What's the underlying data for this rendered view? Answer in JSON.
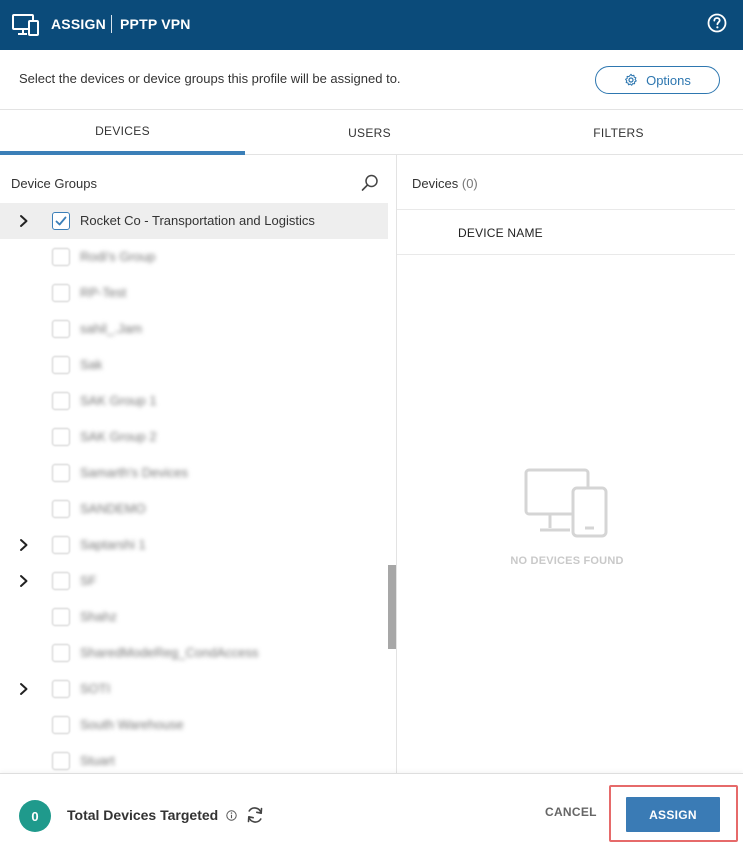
{
  "header": {
    "title": "ASSIGN",
    "subtitle": "PPTP VPN",
    "icons": {
      "app": "monitor-assign-icon",
      "help": "help-circle-icon"
    }
  },
  "subbar": {
    "description": "Select the devices or device groups this profile will be assigned to.",
    "options_label": "Options"
  },
  "tabs": [
    {
      "label": "DEVICES",
      "active": true
    },
    {
      "label": "USERS",
      "active": false
    },
    {
      "label": "FILTERS",
      "active": false
    }
  ],
  "device_groups": {
    "heading": "Device Groups",
    "items": [
      {
        "label": "Rocket Co - Transportation and Logistics",
        "checked": true,
        "expandable": true,
        "selected": true,
        "blurred": false
      },
      {
        "label": "Rodi's Group",
        "checked": false,
        "expandable": false,
        "blurred": true
      },
      {
        "label": "RP-Test",
        "checked": false,
        "expandable": false,
        "blurred": true
      },
      {
        "label": "sahil_.Jam",
        "checked": false,
        "expandable": false,
        "blurred": true
      },
      {
        "label": "Sak",
        "checked": false,
        "expandable": false,
        "blurred": true
      },
      {
        "label": "SAK Group 1",
        "checked": false,
        "expandable": false,
        "blurred": true
      },
      {
        "label": "SAK Group 2",
        "checked": false,
        "expandable": false,
        "blurred": true
      },
      {
        "label": "Samarth's Devices",
        "checked": false,
        "expandable": false,
        "blurred": true
      },
      {
        "label": "SANDEMO",
        "checked": false,
        "expandable": false,
        "blurred": true
      },
      {
        "label": "Saptarshi 1",
        "checked": false,
        "expandable": true,
        "blurred": true
      },
      {
        "label": "SF",
        "checked": false,
        "expandable": true,
        "blurred": true
      },
      {
        "label": "Shahz",
        "checked": false,
        "expandable": false,
        "blurred": true
      },
      {
        "label": "SharedModeReg_CondAccess",
        "checked": false,
        "expandable": false,
        "blurred": true
      },
      {
        "label": "SOTI",
        "checked": false,
        "expandable": true,
        "blurred": true
      },
      {
        "label": "South Warehouse",
        "checked": false,
        "expandable": false,
        "blurred": true
      },
      {
        "label": "Stuart",
        "checked": false,
        "expandable": false,
        "blurred": true
      }
    ]
  },
  "devices": {
    "heading": "Devices",
    "count": "(0)",
    "column_header": "DEVICE NAME",
    "empty_text": "NO DEVICES FOUND"
  },
  "footer": {
    "count": "0",
    "total_label": "Total Devices Targeted",
    "cancel_label": "CANCEL",
    "assign_label": "ASSIGN"
  },
  "colors": {
    "header_bg": "#0b4b7a",
    "accent": "#3a7bb5",
    "badge": "#1f9a8c",
    "highlight_outline": "#e66a6a"
  }
}
